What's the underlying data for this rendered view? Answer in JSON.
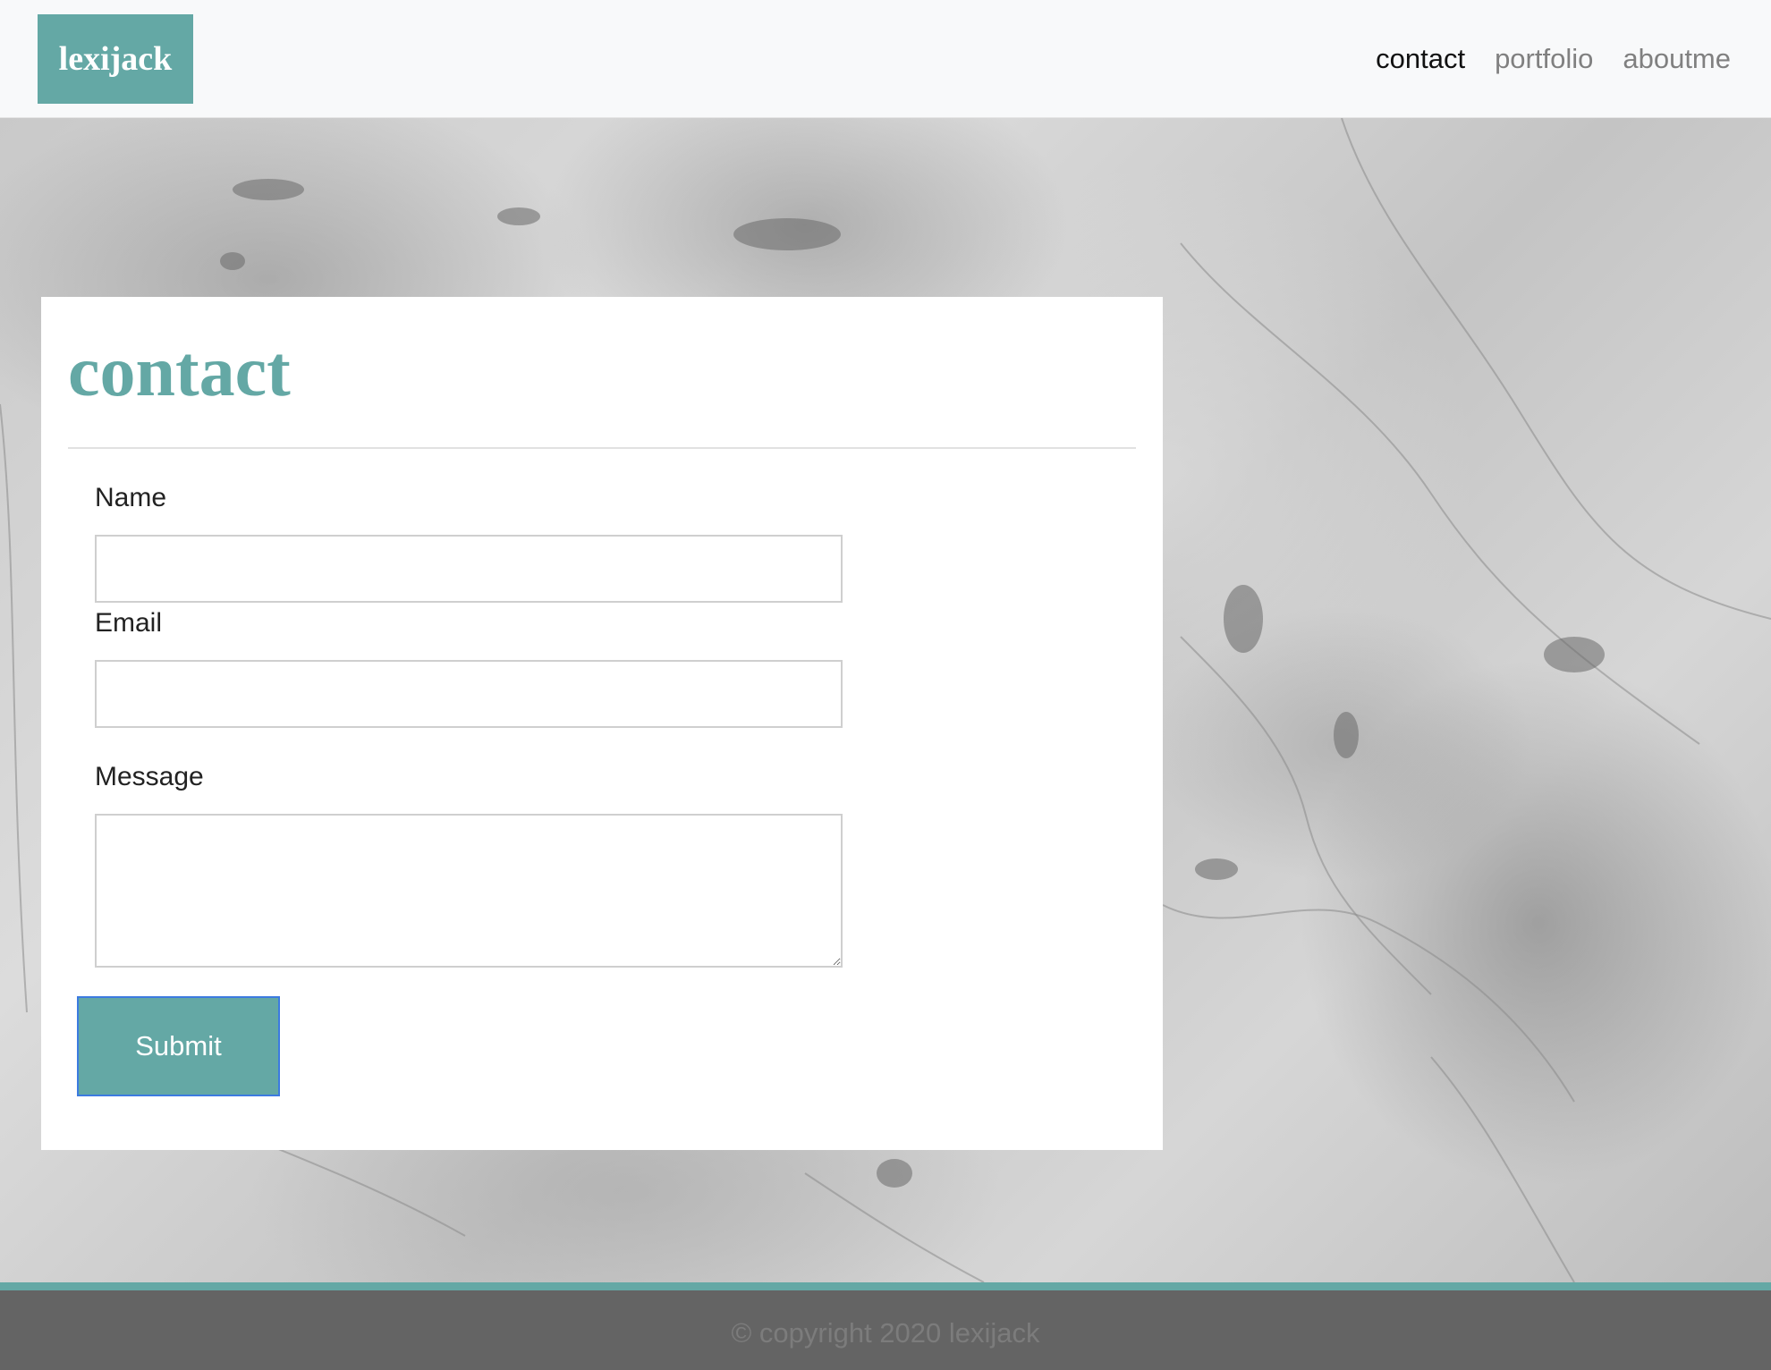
{
  "navbar": {
    "brand": "lexijack",
    "links": [
      {
        "label": "contact",
        "active": true
      },
      {
        "label": "portfolio",
        "active": false
      },
      {
        "label": "aboutme",
        "active": false
      }
    ]
  },
  "contact_form": {
    "title": "contact",
    "name": {
      "label": "Name",
      "value": "",
      "placeholder": ""
    },
    "email": {
      "label": "Email",
      "value": "",
      "placeholder": ""
    },
    "message": {
      "label": "Message",
      "value": "",
      "placeholder": ""
    },
    "submit_label": "Submit"
  },
  "footer": {
    "text": "© copyright 2020 lexijack"
  },
  "colors": {
    "accent": "#64a8a5",
    "nav_background": "#f8f9fa",
    "footer_background": "#646464",
    "card_background": "#ffffff",
    "submit_focus_border": "#3c7be0"
  }
}
